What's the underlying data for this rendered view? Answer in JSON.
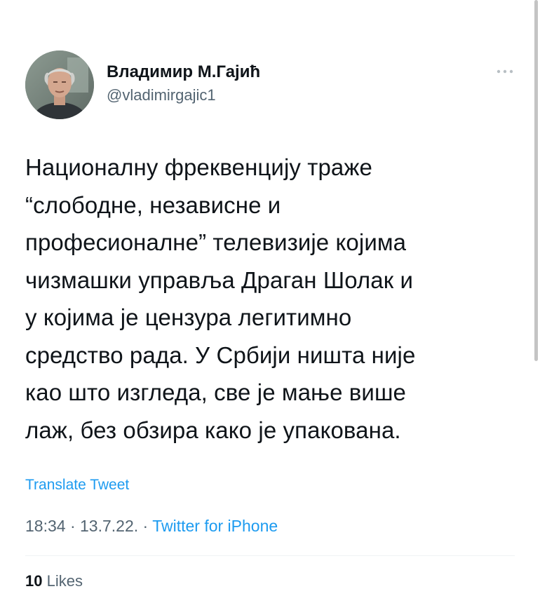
{
  "author": {
    "display_name": "Владимир М.Гајић",
    "handle": "@vladimirgajic1",
    "avatar_icon": "user-avatar-photo"
  },
  "more_icon": "more-horizontal-icon",
  "tweet": {
    "text": "Националну фреквенцију траже\n“слободне, независне и\nпрофесионалне” телевизије којима\nчизмашки управља Драган Шолак и\nу којима је цензура легитимно\nсредство рада. У Србији ништа није\nкао што изгледа, све је мање више\nлаж, без обзира како је упакована."
  },
  "translate_label": "Translate Tweet",
  "meta": {
    "time": "18:34",
    "date": "13.7.22.",
    "separator": "·",
    "source": "Twitter for iPhone"
  },
  "likes": {
    "count": "10",
    "label": "Likes"
  },
  "colors": {
    "text": "#0f1419",
    "secondary": "#536471",
    "link": "#1d9bf0",
    "divider": "#eff3f4"
  }
}
